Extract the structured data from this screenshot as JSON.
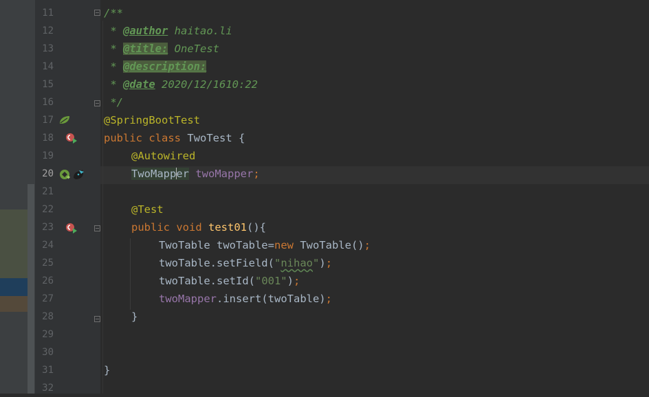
{
  "editor": {
    "lines": [
      {
        "n": "11",
        "doc": "/**"
      },
      {
        "n": "12",
        "star": " * ",
        "tag": "@author",
        "val": " haitao.li"
      },
      {
        "n": "13",
        "star": " * ",
        "tag": "@title:",
        "val": " OneTest"
      },
      {
        "n": "14",
        "star": " * ",
        "tag": "@description:",
        "val": ""
      },
      {
        "n": "15",
        "star": " * ",
        "tag": "@date",
        "val": " 2020/12/1610:22"
      },
      {
        "n": "16",
        "doc": " */"
      },
      {
        "n": "17",
        "ann": "@SpringBootTest"
      },
      {
        "n": "18",
        "kw1": "public",
        "kw2": "class",
        "cls": "TwoTest",
        "rest": " {"
      },
      {
        "n": "19",
        "ann": "@Autowired"
      },
      {
        "n": "20",
        "type_a": "TwoMapp",
        "type_b": "er",
        "field": "twoMapper",
        "semi": ";"
      },
      {
        "n": "21"
      },
      {
        "n": "22",
        "ann": "@Test"
      },
      {
        "n": "23",
        "kw1": "public",
        "kw2": "void",
        "fn": "test01",
        "rest": "(){"
      },
      {
        "n": "24",
        "t1": "TwoTable twoTable=",
        "kw": "new",
        "t2": " TwoTable()",
        "semi": ";"
      },
      {
        "n": "25",
        "t1": "twoTable.setField(",
        "str_typo": "nihao",
        "t2": ")",
        "semi": ";"
      },
      {
        "n": "26",
        "t1": "twoTable.setId(",
        "str": "\"001\"",
        "t2": ")",
        "semi": ";"
      },
      {
        "n": "27",
        "field": "twoMapper",
        "t1": ".insert(twoTable)",
        "semi": ";"
      },
      {
        "n": "28",
        "t1": "}"
      },
      {
        "n": "29"
      },
      {
        "n": "30"
      },
      {
        "n": "31",
        "t1": "}"
      },
      {
        "n": "32"
      }
    ],
    "current_line": "20"
  },
  "gutter_icons": {
    "line17": "spring-leaf-icon",
    "line18": "run-test-class-icon",
    "line20": "bean-injection-icon",
    "line23": "run-test-method-icon"
  },
  "colors": {
    "background": "#2b2b2b",
    "gutter": "#313335",
    "keyword": "#cc7832",
    "annotation": "#bbb529",
    "string": "#6a8759",
    "field": "#9876aa",
    "doc": "#629755",
    "function": "#ffc66d"
  }
}
